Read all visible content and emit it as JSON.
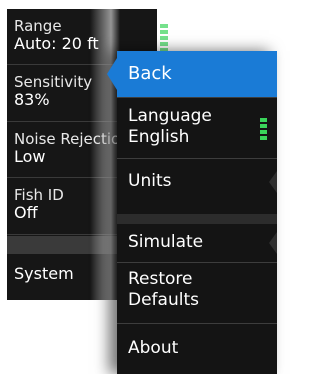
{
  "background_menu": {
    "items": [
      {
        "label": "Range",
        "value": "Auto: 20 ft"
      },
      {
        "label": "Sensitivity",
        "value": "83%"
      },
      {
        "label": "Noise Rejection",
        "value": "Low"
      },
      {
        "label": "Fish ID",
        "value": "Off"
      },
      {
        "label": "System"
      }
    ]
  },
  "submenu": {
    "back_label": "Back",
    "language": {
      "label": "Language",
      "value": "English"
    },
    "units_label": "Units",
    "simulate_label": "Simulate",
    "restore_line1": "Restore",
    "restore_line2": "Defaults",
    "about_label": "About"
  },
  "colors": {
    "selected": "#1a7bd6",
    "scroll_indicator": "#3ad45a",
    "menu_bg": "#141414"
  }
}
